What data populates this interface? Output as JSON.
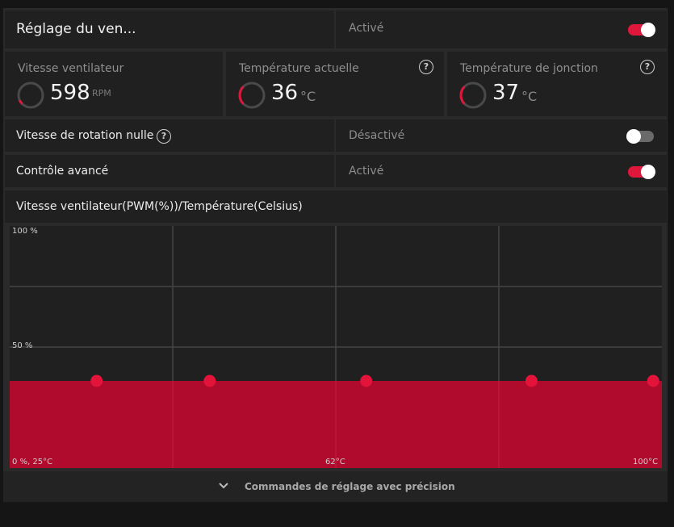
{
  "header": {
    "title": "Réglage du ven...",
    "state": "Activé",
    "toggle_on": true
  },
  "metrics": [
    {
      "title": "Vitesse ventilateur",
      "value": "598",
      "unit": "RPM",
      "help": false
    },
    {
      "title": "Température actuelle",
      "value": "36",
      "unit": "°C",
      "help": true
    },
    {
      "title": "Température de jonction",
      "value": "37",
      "unit": "°C",
      "help": true
    }
  ],
  "zero_rpm": {
    "label": "Vitesse de rotation nulle",
    "state": "Désactivé",
    "toggle_on": false
  },
  "advanced": {
    "label": "Contrôle avancé",
    "state": "Activé",
    "toggle_on": true
  },
  "curve_title": "Vitesse ventilateur(PWM(%))/Température(Celsius)",
  "chart_data": {
    "type": "area",
    "y_ticks": [
      "100 %",
      "50 %"
    ],
    "x_ticks": [
      "0 %, 25°C",
      "62°C",
      "100°C"
    ],
    "ylim": [
      0,
      100
    ],
    "xlim": [
      25,
      100
    ],
    "points": [
      {
        "x": 35,
        "y": 36
      },
      {
        "x": 48,
        "y": 36
      },
      {
        "x": 66,
        "y": 36
      },
      {
        "x": 85,
        "y": 36
      },
      {
        "x": 99,
        "y": 36
      }
    ],
    "fill_color": "#b00a2c",
    "point_color": "#e4133a",
    "grid": true
  },
  "footer": {
    "label": "Commandes de réglage avec précision"
  },
  "colors": {
    "accent": "#e0173c"
  }
}
